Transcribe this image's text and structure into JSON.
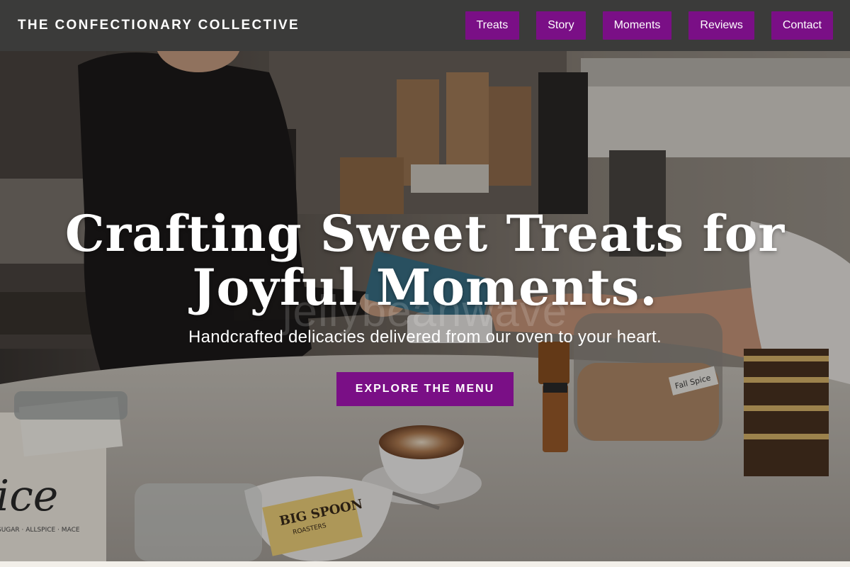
{
  "header": {
    "brand": "THE CONFECTIONARY COLLECTIVE",
    "nav": [
      "Treats",
      "Story",
      "Moments",
      "Reviews",
      "Contact"
    ]
  },
  "hero": {
    "title": "Crafting Sweet Treats for Joyful Moments.",
    "watermark": "jellybeanwave",
    "subtitle": "Handcrafted delicacies delivered from our oven to your heart.",
    "cta": "EXPLORE THE MENU",
    "photo_labels": {
      "jar_label": "Fall Spice",
      "bag_brand": "BIG SPOON",
      "bag_sub": "ROASTERS",
      "sign_word": "ice",
      "sign_small": "SUGAR · ALLSPICE · MACE"
    }
  },
  "colors": {
    "header_bg": "#3b3b3a",
    "accent": "#7a0f86",
    "text_light": "#ffffff"
  }
}
